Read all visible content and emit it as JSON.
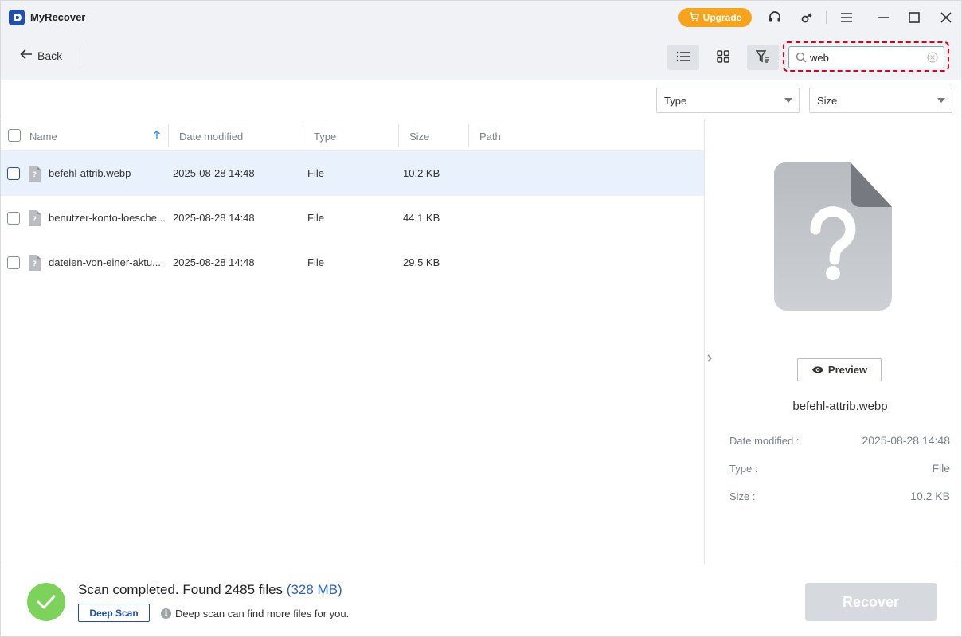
{
  "app": {
    "title": "MyRecover"
  },
  "titlebar": {
    "upgrade_label": "Upgrade",
    "icons": [
      "headset-icon",
      "key-icon",
      "menu-icon",
      "minimize-icon",
      "maximize-icon",
      "close-icon"
    ]
  },
  "toolbar": {
    "back_label": "Back",
    "search": {
      "value": "web"
    },
    "active_view": "list"
  },
  "filters": {
    "type_label": "Type",
    "size_label": "Size"
  },
  "list": {
    "columns": {
      "name": "Name",
      "date": "Date modified",
      "type": "Type",
      "size": "Size",
      "path": "Path"
    },
    "sort": {
      "column": "name",
      "direction": "ascending"
    },
    "rows": [
      {
        "name": "befehl-attrib.webp",
        "date": "2025-08-28 14:48",
        "type": "File",
        "size": "10.2 KB",
        "path": "",
        "selected": true
      },
      {
        "name": "benutzer-konto-loesche...",
        "date": "2025-08-28 14:48",
        "type": "File",
        "size": "44.1 KB",
        "path": "",
        "selected": false
      },
      {
        "name": "dateien-von-einer-aktu...",
        "date": "2025-08-28 14:48",
        "type": "File",
        "size": "29.5 KB",
        "path": "",
        "selected": false
      }
    ]
  },
  "preview": {
    "button_label": "Preview",
    "filename": "befehl-attrib.webp",
    "date_label": "Date modified :",
    "date_value": "2025-08-28 14:48",
    "type_label": "Type :",
    "type_value": "File",
    "size_label": "Size :",
    "size_value": "10.2 KB"
  },
  "footer": {
    "status_text": "Scan completed. Found 2485 files",
    "status_size": "(328 MB)",
    "deep_scan_label": "Deep Scan",
    "deep_scan_hint": "Deep scan can find more files for you.",
    "recover_label": "Recover"
  },
  "colors": {
    "brand": "#1f4fb5",
    "upgrade": "#f7a31c",
    "success": "#7dd25c",
    "selected_row": "#e8f1fc",
    "highlight_outline": "#e00010",
    "recover_disabled": "#d6d9dd"
  }
}
